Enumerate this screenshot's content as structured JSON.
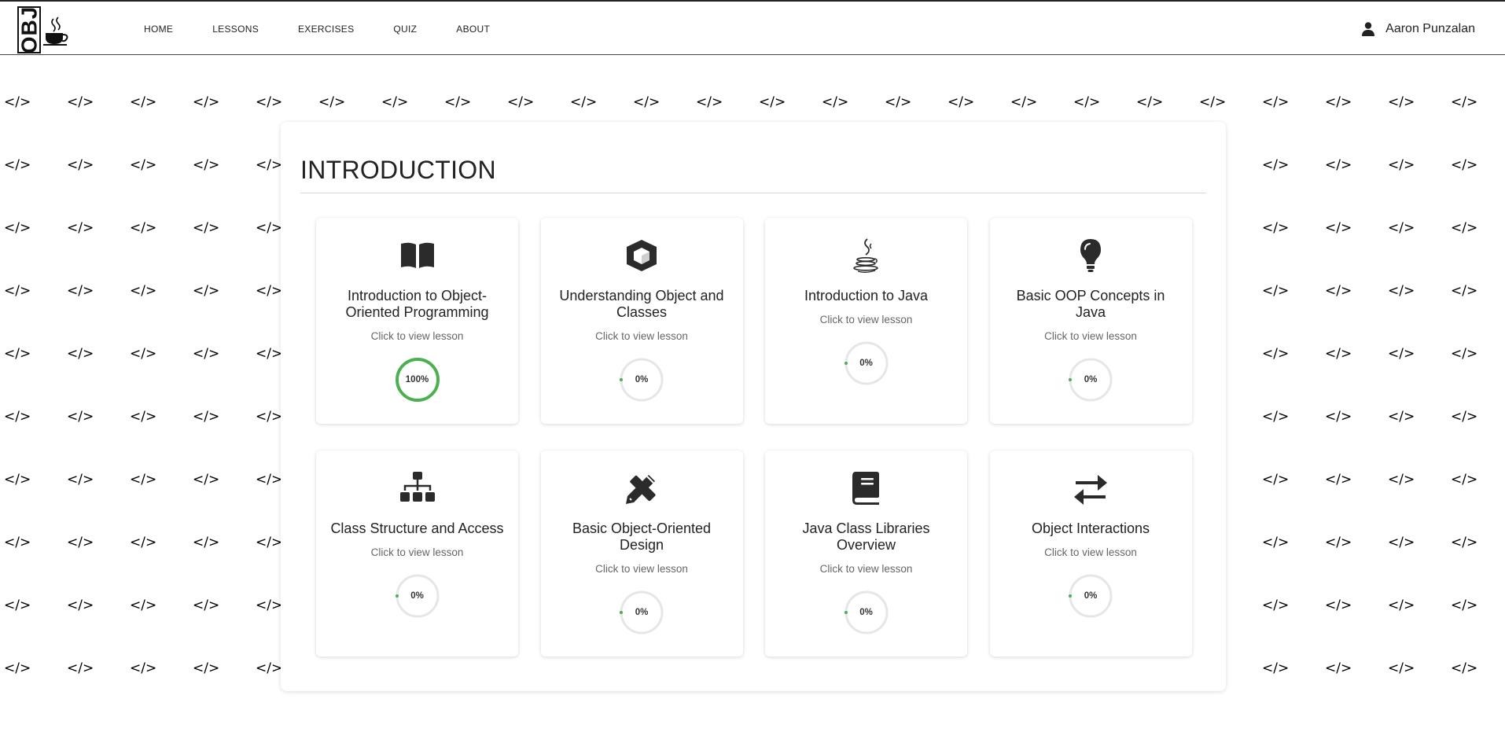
{
  "nav": {
    "logo_text": "OBJ",
    "links": [
      {
        "label": "HOME"
      },
      {
        "label": "LESSONS"
      },
      {
        "label": "EXERCISES"
      },
      {
        "label": "QUIZ"
      },
      {
        "label": "ABOUT"
      }
    ],
    "user_name": "Aaron Punzalan"
  },
  "background_glyph": "</>",
  "section": {
    "title": "INTRODUCTION",
    "lessons": [
      {
        "title": "Introduction to Object-Oriented Programming",
        "subtitle": "Click to view lesson",
        "progress": 100,
        "progress_label": "100%",
        "icon": "book-open-icon"
      },
      {
        "title": "Understanding Object and Classes",
        "subtitle": "Click to view lesson",
        "progress": 0,
        "progress_label": "0%",
        "icon": "cube-icon"
      },
      {
        "title": "Introduction to Java",
        "subtitle": "Click to view lesson",
        "progress": 0,
        "progress_label": "0%",
        "icon": "java-icon"
      },
      {
        "title": "Basic OOP Concepts in Java",
        "subtitle": "Click to view lesson",
        "progress": 0,
        "progress_label": "0%",
        "icon": "lightbulb-icon"
      },
      {
        "title": "Class Structure and Access",
        "subtitle": "Click to view lesson",
        "progress": 0,
        "progress_label": "0%",
        "icon": "sitemap-icon"
      },
      {
        "title": "Basic Object-Oriented Design",
        "subtitle": "Click to view lesson",
        "progress": 0,
        "progress_label": "0%",
        "icon": "pencil-ruler-icon"
      },
      {
        "title": "Java Class Libraries Overview",
        "subtitle": "Click to view lesson",
        "progress": 0,
        "progress_label": "0%",
        "icon": "book-icon"
      },
      {
        "title": "Object Interactions",
        "subtitle": "Click to view lesson",
        "progress": 0,
        "progress_label": "0%",
        "icon": "exchange-arrows-icon"
      }
    ]
  },
  "colors": {
    "progress_complete": "#4caf50",
    "progress_track": "#e6e6e6",
    "icon": "#2b2b2b"
  }
}
